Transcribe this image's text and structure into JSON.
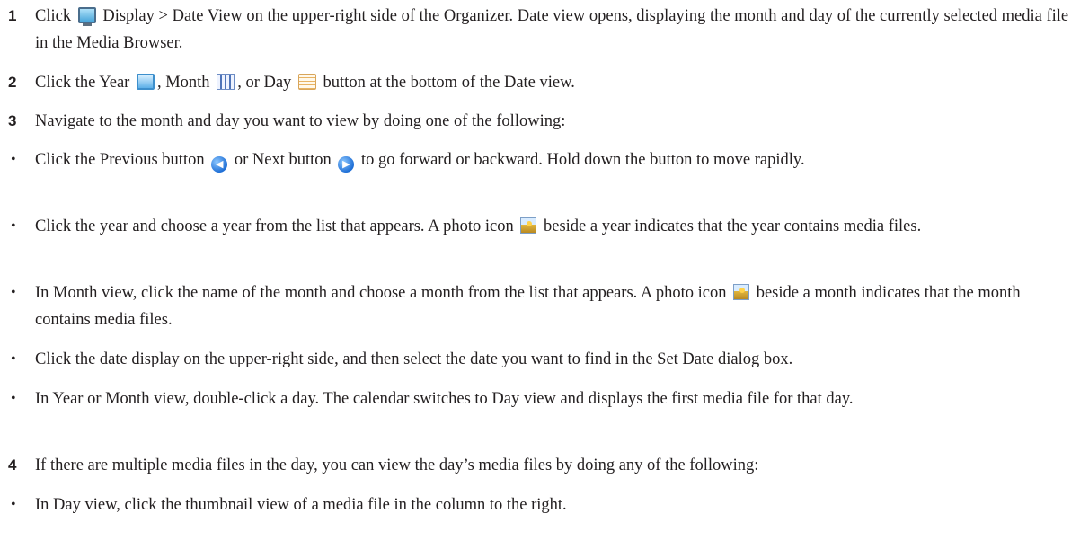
{
  "steps": {
    "s1": {
      "num": "1",
      "a": "Click",
      "b": "Display > Date View on the upper-right side of the Organizer. Date view opens, displaying the month and day of the currently selected media file in the Media Browser."
    },
    "s2": {
      "num": "2",
      "a": "Click the Year",
      "b": ", Month",
      "c": ", or Day",
      "d": "button at the bottom of the Date view."
    },
    "s3": {
      "num": "3",
      "text": "Navigate to the month and day you want to view by doing one of the following:"
    },
    "b1": {
      "bullet": "•",
      "a": "Click the Previous button",
      "b": "or Next button",
      "c": "to go forward or backward. Hold down the button to move rapidly."
    },
    "b2": {
      "bullet": "•",
      "a": "Click the year and choose a year from the list that appears. A photo icon",
      "b": "beside a year indicates that the year contains media files."
    },
    "b3": {
      "bullet": "•",
      "a": "In Month view, click the name of the month and choose a month from the list that appears. A photo icon",
      "b": "beside a month indicates that the month contains media files."
    },
    "b4": {
      "bullet": "•",
      "text": "Click the date display on the upper-right side, and then select the date you want to find in the Set Date dialog box."
    },
    "b5": {
      "bullet": "•",
      "text": "In Year or Month view, double-click a day. The calendar switches to Day view and displays the first media file for that day."
    },
    "s4": {
      "num": "4",
      "text": "If there are multiple media files in the day, you can view the day’s media files by doing any of the following:"
    },
    "b6": {
      "bullet": "•",
      "text": "In Day view, click the thumbnail view of a media file in the column to the right."
    }
  },
  "icons": {
    "display": "display-monitor-icon",
    "year": "year-view-icon",
    "month": "month-view-icon",
    "day": "day-view-icon",
    "previous": "previous-arrow-icon",
    "next": "next-arrow-icon",
    "photo": "photo-icon"
  },
  "glyphs": {
    "prev": "◀",
    "next": "▶"
  }
}
